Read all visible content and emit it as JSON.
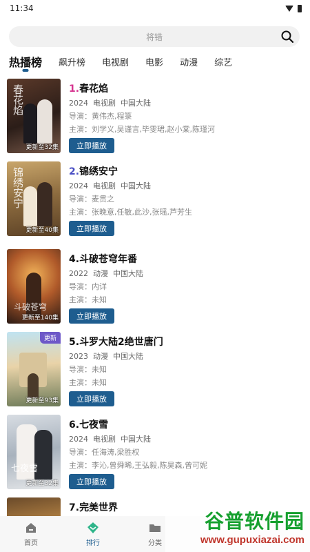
{
  "status_bar": {
    "time": "11:34"
  },
  "search": {
    "placeholder": "将错"
  },
  "tabs": [
    {
      "label": "热播榜",
      "active": true
    },
    {
      "label": "飙升榜",
      "active": false
    },
    {
      "label": "电视剧",
      "active": false
    },
    {
      "label": "电影",
      "active": false
    },
    {
      "label": "动漫",
      "active": false
    },
    {
      "label": "综艺",
      "active": false
    }
  ],
  "colors": {
    "accent": "#1e5d8f",
    "rank1": "#d6348f",
    "rank2": "#4a4fc4",
    "badge": "#6e58c8"
  },
  "items": [
    {
      "rank": "1.",
      "name": "春花焰",
      "year": "2024",
      "type": "电视剧",
      "region": "中国大陆",
      "director": "导演：黄伟杰,程箓",
      "cast": "主演：刘学义,吴谨言,毕雯珺,赵小棠,陈瑾河",
      "episode": "更新至32集",
      "badge": "",
      "button": "立即播放",
      "poster_text": "春花焰"
    },
    {
      "rank": "2.",
      "name": "锦绣安宁",
      "year": "2024",
      "type": "电视剧",
      "region": "中国大陆",
      "director": "导演：麦贯之",
      "cast": "主演：张晚意,任敏,此沙,张瑶,芦芳生",
      "episode": "更新至40集",
      "badge": "",
      "button": "立即播放",
      "poster_text": "锦绣安宁"
    },
    {
      "rank": "4.",
      "name": "斗破苍穹年番",
      "year": "2022",
      "type": "动漫",
      "region": "中国大陆",
      "director": "导演：内详",
      "cast": "主演：未知",
      "episode": "更新至140集",
      "badge": "",
      "button": "立即播放",
      "poster_text": "斗破苍穹"
    },
    {
      "rank": "5.",
      "name": "斗罗大陆2绝世唐门",
      "year": "2023",
      "type": "动漫",
      "region": "中国大陆",
      "director": "导演：未知",
      "cast": "主演：未知",
      "episode": "更新至93集",
      "badge": "更新",
      "button": "立即播放",
      "poster_text": ""
    },
    {
      "rank": "6.",
      "name": "七夜雪",
      "year": "2024",
      "type": "电视剧",
      "region": "中国大陆",
      "director": "导演：任海涛,梁胜权",
      "cast": "主演：李沁,曾舜晞,王弘毅,陈昊森,曾可妮",
      "episode": "更新至32集",
      "badge": "",
      "button": "立即播放",
      "poster_text": "七夜雪"
    },
    {
      "rank": "7.",
      "name": "完美世界",
      "year": "",
      "type": "",
      "region": "",
      "director": "",
      "cast": "",
      "episode": "",
      "badge": "",
      "button": "",
      "poster_text": ""
    }
  ],
  "bottom_nav": [
    {
      "label": "首页",
      "icon": "home-icon",
      "active": false
    },
    {
      "label": "排行",
      "icon": "ranking-icon",
      "active": true
    },
    {
      "label": "分类",
      "icon": "folder-icon",
      "active": false
    }
  ],
  "watermark": {
    "title": "谷普软件园",
    "url": "www.gupuxiazai.com"
  }
}
